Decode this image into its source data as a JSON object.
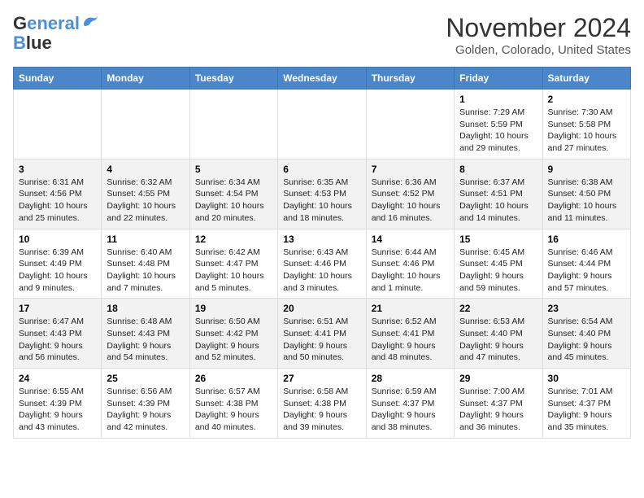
{
  "header": {
    "logo_general": "General",
    "logo_blue": "Blue",
    "month": "November 2024",
    "location": "Golden, Colorado, United States"
  },
  "calendar": {
    "weekdays": [
      "Sunday",
      "Monday",
      "Tuesday",
      "Wednesday",
      "Thursday",
      "Friday",
      "Saturday"
    ],
    "weeks": [
      [
        {
          "day": "",
          "info": ""
        },
        {
          "day": "",
          "info": ""
        },
        {
          "day": "",
          "info": ""
        },
        {
          "day": "",
          "info": ""
        },
        {
          "day": "",
          "info": ""
        },
        {
          "day": "1",
          "info": "Sunrise: 7:29 AM\nSunset: 5:59 PM\nDaylight: 10 hours\nand 29 minutes."
        },
        {
          "day": "2",
          "info": "Sunrise: 7:30 AM\nSunset: 5:58 PM\nDaylight: 10 hours\nand 27 minutes."
        }
      ],
      [
        {
          "day": "3",
          "info": "Sunrise: 6:31 AM\nSunset: 4:56 PM\nDaylight: 10 hours\nand 25 minutes."
        },
        {
          "day": "4",
          "info": "Sunrise: 6:32 AM\nSunset: 4:55 PM\nDaylight: 10 hours\nand 22 minutes."
        },
        {
          "day": "5",
          "info": "Sunrise: 6:34 AM\nSunset: 4:54 PM\nDaylight: 10 hours\nand 20 minutes."
        },
        {
          "day": "6",
          "info": "Sunrise: 6:35 AM\nSunset: 4:53 PM\nDaylight: 10 hours\nand 18 minutes."
        },
        {
          "day": "7",
          "info": "Sunrise: 6:36 AM\nSunset: 4:52 PM\nDaylight: 10 hours\nand 16 minutes."
        },
        {
          "day": "8",
          "info": "Sunrise: 6:37 AM\nSunset: 4:51 PM\nDaylight: 10 hours\nand 14 minutes."
        },
        {
          "day": "9",
          "info": "Sunrise: 6:38 AM\nSunset: 4:50 PM\nDaylight: 10 hours\nand 11 minutes."
        }
      ],
      [
        {
          "day": "10",
          "info": "Sunrise: 6:39 AM\nSunset: 4:49 PM\nDaylight: 10 hours\nand 9 minutes."
        },
        {
          "day": "11",
          "info": "Sunrise: 6:40 AM\nSunset: 4:48 PM\nDaylight: 10 hours\nand 7 minutes."
        },
        {
          "day": "12",
          "info": "Sunrise: 6:42 AM\nSunset: 4:47 PM\nDaylight: 10 hours\nand 5 minutes."
        },
        {
          "day": "13",
          "info": "Sunrise: 6:43 AM\nSunset: 4:46 PM\nDaylight: 10 hours\nand 3 minutes."
        },
        {
          "day": "14",
          "info": "Sunrise: 6:44 AM\nSunset: 4:46 PM\nDaylight: 10 hours\nand 1 minute."
        },
        {
          "day": "15",
          "info": "Sunrise: 6:45 AM\nSunset: 4:45 PM\nDaylight: 9 hours\nand 59 minutes."
        },
        {
          "day": "16",
          "info": "Sunrise: 6:46 AM\nSunset: 4:44 PM\nDaylight: 9 hours\nand 57 minutes."
        }
      ],
      [
        {
          "day": "17",
          "info": "Sunrise: 6:47 AM\nSunset: 4:43 PM\nDaylight: 9 hours\nand 56 minutes."
        },
        {
          "day": "18",
          "info": "Sunrise: 6:48 AM\nSunset: 4:43 PM\nDaylight: 9 hours\nand 54 minutes."
        },
        {
          "day": "19",
          "info": "Sunrise: 6:50 AM\nSunset: 4:42 PM\nDaylight: 9 hours\nand 52 minutes."
        },
        {
          "day": "20",
          "info": "Sunrise: 6:51 AM\nSunset: 4:41 PM\nDaylight: 9 hours\nand 50 minutes."
        },
        {
          "day": "21",
          "info": "Sunrise: 6:52 AM\nSunset: 4:41 PM\nDaylight: 9 hours\nand 48 minutes."
        },
        {
          "day": "22",
          "info": "Sunrise: 6:53 AM\nSunset: 4:40 PM\nDaylight: 9 hours\nand 47 minutes."
        },
        {
          "day": "23",
          "info": "Sunrise: 6:54 AM\nSunset: 4:40 PM\nDaylight: 9 hours\nand 45 minutes."
        }
      ],
      [
        {
          "day": "24",
          "info": "Sunrise: 6:55 AM\nSunset: 4:39 PM\nDaylight: 9 hours\nand 43 minutes."
        },
        {
          "day": "25",
          "info": "Sunrise: 6:56 AM\nSunset: 4:39 PM\nDaylight: 9 hours\nand 42 minutes."
        },
        {
          "day": "26",
          "info": "Sunrise: 6:57 AM\nSunset: 4:38 PM\nDaylight: 9 hours\nand 40 minutes."
        },
        {
          "day": "27",
          "info": "Sunrise: 6:58 AM\nSunset: 4:38 PM\nDaylight: 9 hours\nand 39 minutes."
        },
        {
          "day": "28",
          "info": "Sunrise: 6:59 AM\nSunset: 4:37 PM\nDaylight: 9 hours\nand 38 minutes."
        },
        {
          "day": "29",
          "info": "Sunrise: 7:00 AM\nSunset: 4:37 PM\nDaylight: 9 hours\nand 36 minutes."
        },
        {
          "day": "30",
          "info": "Sunrise: 7:01 AM\nSunset: 4:37 PM\nDaylight: 9 hours\nand 35 minutes."
        }
      ]
    ]
  }
}
